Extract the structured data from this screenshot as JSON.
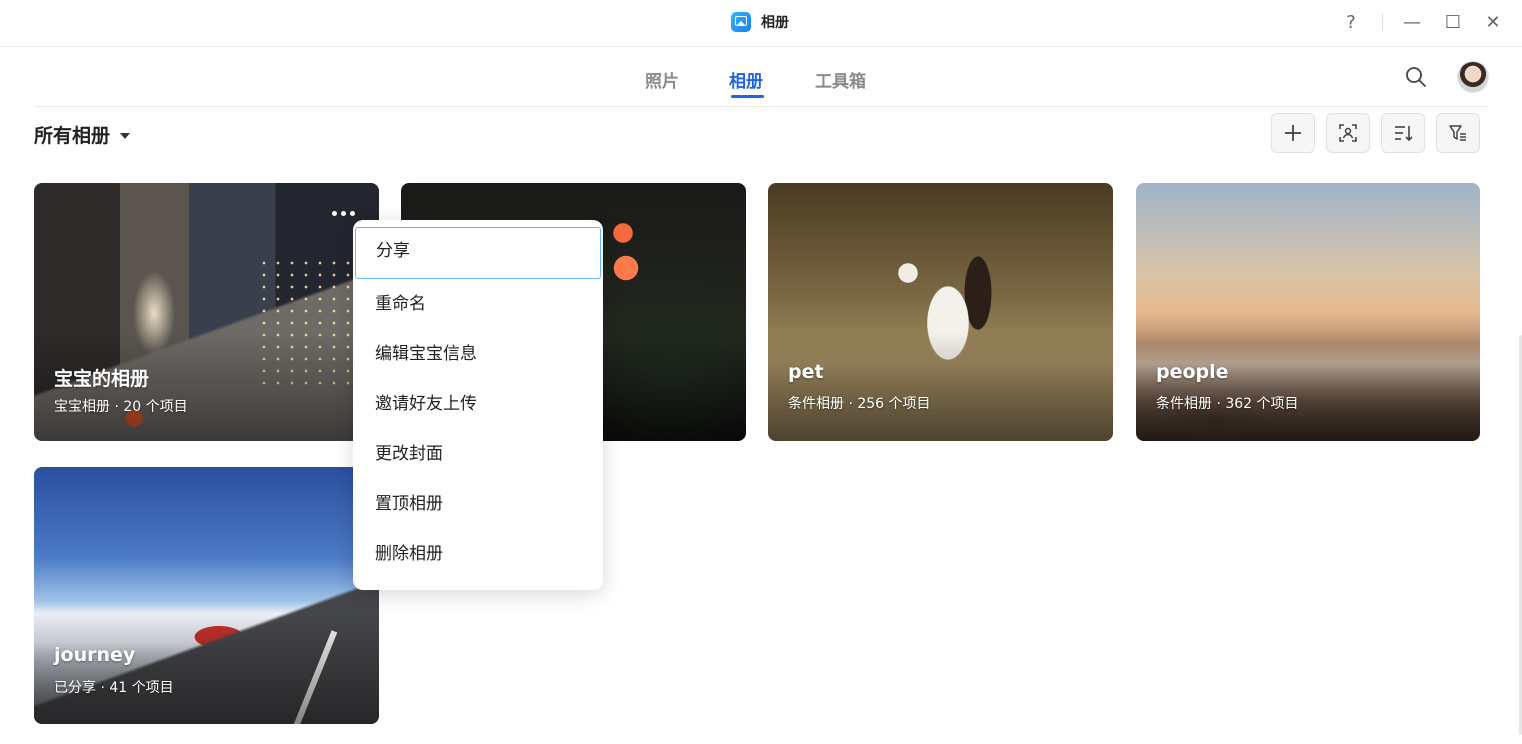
{
  "window": {
    "title": "相册",
    "help_glyph": "?",
    "minimize_glyph": "—",
    "maximize_glyph": "☐",
    "close_glyph": "✕"
  },
  "nav": {
    "tabs": [
      {
        "label": "照片",
        "active": false
      },
      {
        "label": "相册",
        "active": true
      },
      {
        "label": "工具箱",
        "active": false
      }
    ],
    "accent_color": "#1f64e0"
  },
  "toolbar": {
    "filter_label": "所有相册",
    "buttons": [
      "plus-icon",
      "face-scan-icon",
      "sort-icon",
      "filter-icon"
    ]
  },
  "albums": [
    {
      "name": "宝宝的相册",
      "meta": "宝宝相册 · 20 个项目",
      "has_more_menu": true
    },
    {
      "name": "",
      "meta": ""
    },
    {
      "name": "pet",
      "meta": "条件相册 · 256 个项目"
    },
    {
      "name": "people",
      "meta": "条件相册 · 362 个项目"
    },
    {
      "name": "journey",
      "meta": "已分享 · 41 个项目"
    }
  ],
  "context_menu": {
    "items": [
      "分享",
      "重命名",
      "编辑宝宝信息",
      "邀请好友上传",
      "更改封面",
      "置顶相册",
      "删除相册"
    ],
    "focused_index": 0
  }
}
